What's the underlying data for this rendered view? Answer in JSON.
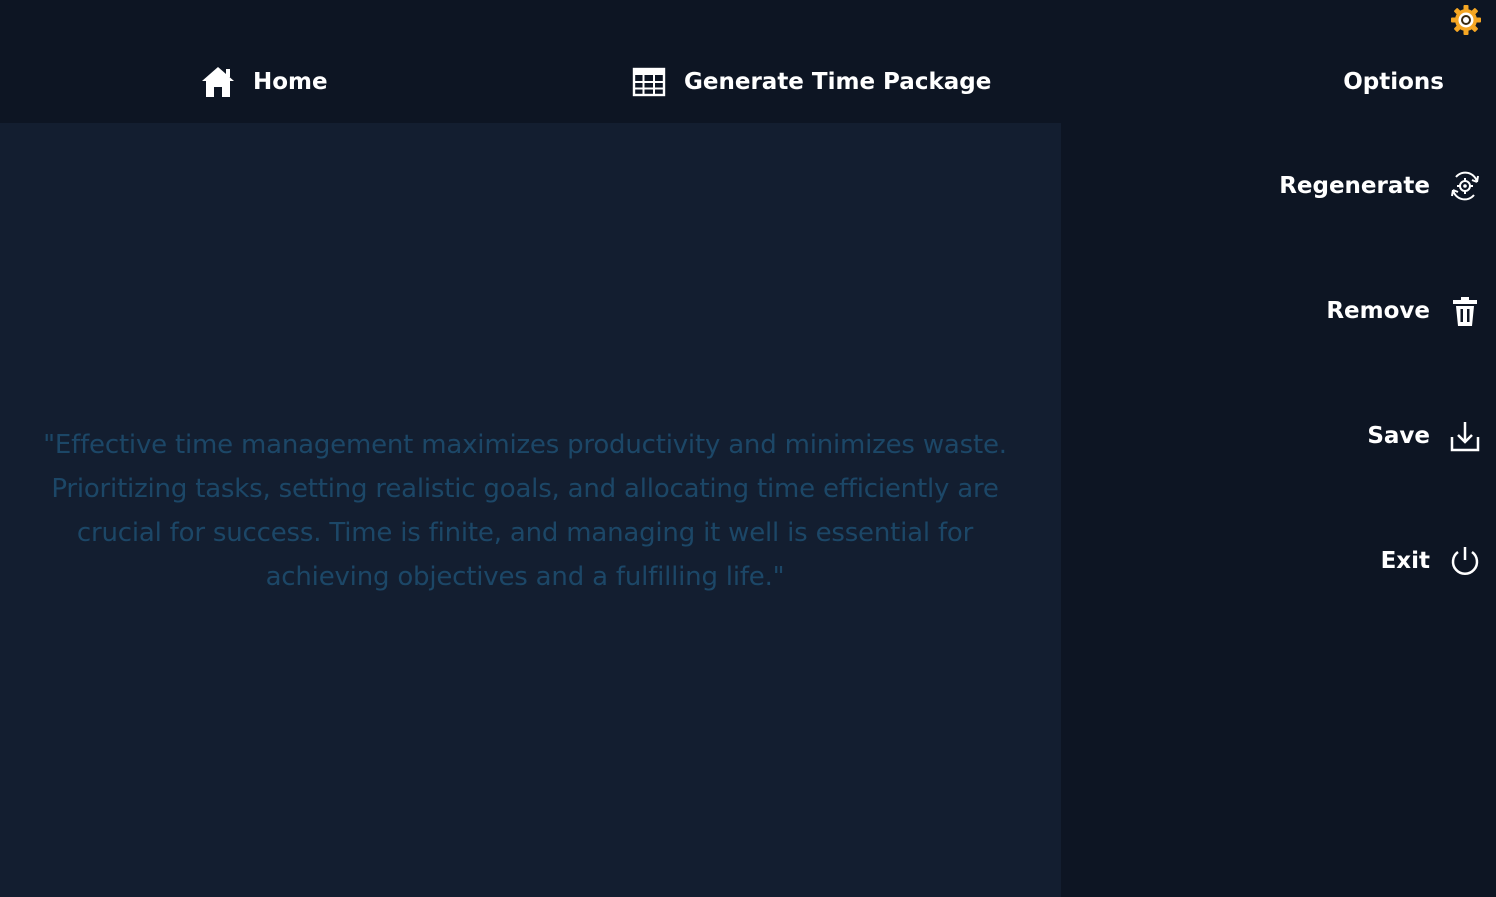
{
  "nav": {
    "home_label": "Home",
    "generate_label": "Generate Time Package",
    "home_icon": "home-icon",
    "generate_icon": "table-grid-icon"
  },
  "main": {
    "quote": "\"Effective time management maximizes productivity and minimizes waste. Prioritizing tasks, setting realistic goals, and allocating time efficiently are crucial for success. Time is finite, and managing it well is essential for achieving objectives and a fulfilling life.\""
  },
  "sidebar": {
    "title": "Options",
    "settings_icon": "gear-icon",
    "buttons": [
      {
        "label": "Regenerate",
        "icon": "regenerate-icon"
      },
      {
        "label": "Remove",
        "icon": "trash-icon"
      },
      {
        "label": "Save",
        "icon": "download-icon"
      },
      {
        "label": "Exit",
        "icon": "power-icon"
      }
    ]
  },
  "colors": {
    "background": "#0d1523",
    "panel": "#131e30",
    "quote_text": "#1c4767",
    "accent_gear": "#f5a623",
    "text": "#ffffff"
  }
}
